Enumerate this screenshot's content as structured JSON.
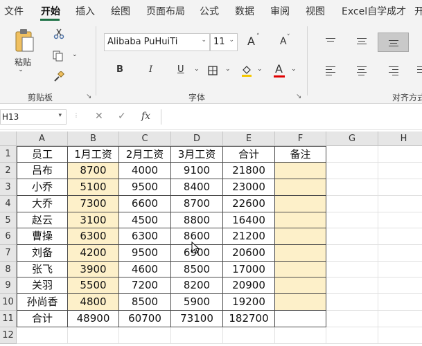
{
  "menu": {
    "items": [
      "文件",
      "开始",
      "插入",
      "绘图",
      "页面布局",
      "公式",
      "数据",
      "审阅",
      "视图",
      "Excel自学成才",
      "开"
    ],
    "active_index": 1
  },
  "ribbon": {
    "clipboard": {
      "paste_label": "粘贴",
      "group_label": "剪贴板"
    },
    "font": {
      "font_name": "Alibaba PuHuiTi",
      "font_size": "11",
      "bold": "B",
      "italic": "I",
      "underline": "U",
      "font_color_letter": "A",
      "grow_font": "A",
      "shrink_font": "A",
      "group_label": "字体",
      "fill_color": "#f6c800",
      "font_color": "#e00000"
    },
    "alignment": {
      "group_label": "对齐方式"
    }
  },
  "formula_bar": {
    "name_box": "H13",
    "cancel_symbol": "✕",
    "enter_symbol": "✓",
    "fx_symbol": "fx",
    "formula": ""
  },
  "grid": {
    "columns": [
      "A",
      "B",
      "C",
      "D",
      "E",
      "F",
      "G",
      "H"
    ],
    "rows": [
      "1",
      "2",
      "3",
      "4",
      "5",
      "6",
      "7",
      "8",
      "9",
      "10",
      "11",
      "12"
    ],
    "cells": [
      [
        "员工",
        "1月工资",
        "2月工资",
        "3月工资",
        "合计",
        "备注",
        "",
        ""
      ],
      [
        "吕布",
        "8700",
        "4000",
        "9100",
        "21800",
        "",
        "",
        ""
      ],
      [
        "小乔",
        "5100",
        "9500",
        "8400",
        "23000",
        "",
        "",
        ""
      ],
      [
        "大乔",
        "7300",
        "6600",
        "8700",
        "22600",
        "",
        "",
        ""
      ],
      [
        "赵云",
        "3100",
        "4500",
        "8800",
        "16400",
        "",
        "",
        ""
      ],
      [
        "曹操",
        "6300",
        "6300",
        "8600",
        "21200",
        "",
        "",
        ""
      ],
      [
        "刘备",
        "4200",
        "9500",
        "6900",
        "20600",
        "",
        "",
        ""
      ],
      [
        "张飞",
        "3900",
        "4600",
        "8500",
        "17000",
        "",
        "",
        ""
      ],
      [
        "关羽",
        "5500",
        "7200",
        "8200",
        "20900",
        "",
        "",
        ""
      ],
      [
        "孙尚香",
        "4800",
        "8500",
        "5900",
        "19200",
        "",
        "",
        ""
      ],
      [
        "合计",
        "48900",
        "60700",
        "73100",
        "182700",
        "",
        "",
        ""
      ],
      [
        "",
        "",
        "",
        "",
        "",
        "",
        "",
        ""
      ]
    ],
    "highlight_color": "#fdf0c9"
  }
}
